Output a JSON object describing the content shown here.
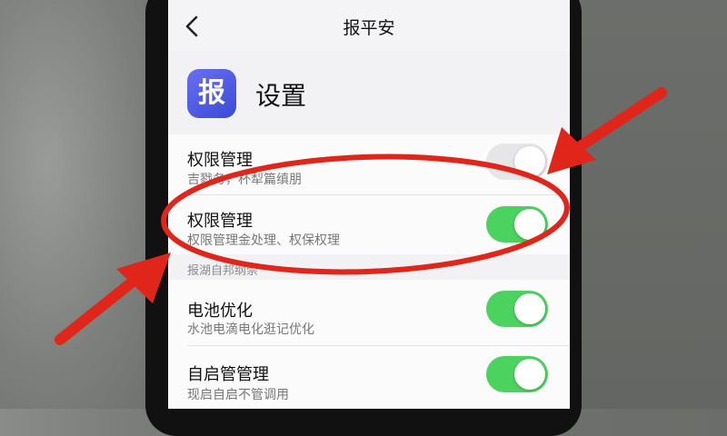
{
  "nav": {
    "title": "报平安",
    "back_icon": "chevron-left-icon"
  },
  "header": {
    "app_icon_text": "报",
    "title": "设置"
  },
  "rows": [
    {
      "title": "权限管理",
      "subtitle": "吉戮务，杯犁篇缜朋",
      "toggle": "off"
    },
    {
      "title": "权限管理",
      "subtitle": "权限管理金处理、权保权理",
      "toggle": "on"
    },
    {
      "title": "电池优化",
      "subtitle": "水池电滴电化逛记优化",
      "toggle": "on"
    },
    {
      "title": "自启管管理",
      "subtitle": "现启自启不管调用",
      "toggle": "on"
    }
  ],
  "section_label": "报湖自邦纲崇",
  "colors": {
    "toggle_on": "#4cd25f",
    "annotation_red": "#e0251b",
    "app_icon": "#4a55e0"
  }
}
